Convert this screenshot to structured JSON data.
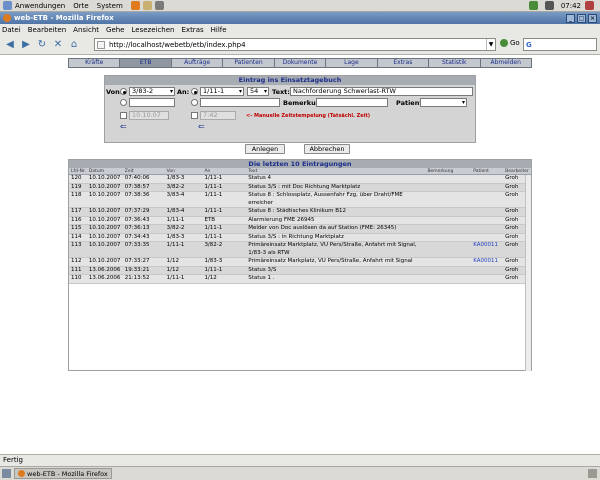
{
  "panel": {
    "menus": [
      "Anwendungen",
      "Orte",
      "System"
    ],
    "clock": "07:42"
  },
  "window": {
    "title": "web-ETB - Mozilla Firefox",
    "controls": [
      "_",
      "□",
      "×"
    ]
  },
  "menubar": [
    "Datei",
    "Bearbeiten",
    "Ansicht",
    "Gehe",
    "Lesezeichen",
    "Extras",
    "Hilfe"
  ],
  "nav": {
    "icons": [
      "back-icon",
      "forward-icon",
      "reload-icon",
      "stop-icon",
      "home-icon"
    ],
    "glyphs": [
      "◀",
      "▶",
      "↻",
      "✕",
      "⌂"
    ],
    "url": "http://localhost/webetb/etb/index.php4",
    "go_label": "Go",
    "search_logo": "G"
  },
  "tabs": [
    {
      "label": "Kräfte",
      "active": false
    },
    {
      "label": "ETB",
      "active": true
    },
    {
      "label": "Aufträge",
      "active": false
    },
    {
      "label": "Patienten",
      "active": false
    },
    {
      "label": "Dokumente",
      "active": false
    },
    {
      "label": "Lage",
      "active": false
    },
    {
      "label": "Extras",
      "active": false
    },
    {
      "label": "Statistik",
      "active": false
    },
    {
      "label": "Abmelden",
      "active": false
    }
  ],
  "entry": {
    "title": "Eintrag ins Einsatztagebuch",
    "von_label": "Von:",
    "an_label": "An:",
    "text_label": "Text:",
    "bemerkung_label": "Bemerkung:",
    "patient_label": "Patient:",
    "von_value": "3/83-2",
    "an_value": "1/11-1",
    "prio_value": "54",
    "text_value": "Nachforderung Schwerlast-RTW",
    "date_value": "10.10.07",
    "time_value": "7:42",
    "arrow_left": "⇐",
    "warning": "<- Manuelle Zeitstempelung (Tatsächl. Zeit)"
  },
  "buttons": {
    "add": "Anlegen",
    "cancel": "Abbrechen"
  },
  "list": {
    "title": "Die letzten 10 Eintragungen",
    "columns": [
      "Lfd-Nr.",
      "Datum",
      "Zeit",
      "Von",
      "An",
      "Text",
      "Bemerkung",
      "Patient",
      "Bearbeiter"
    ],
    "rows": [
      {
        "nr": "120",
        "date": "10.10.2007",
        "time": "07:40:06",
        "von": "1/83-3",
        "an": "1/11-1",
        "text": "Status 4",
        "bem": "",
        "pat": "",
        "bea": "Groh"
      },
      {
        "nr": "119",
        "date": "10.10.2007",
        "time": "07:38:57",
        "von": "3/82-2",
        "an": "1/11-1",
        "text": "Status 3/S : mit Doc Richtung Marktplatz",
        "bem": "",
        "pat": "",
        "bea": "Groh"
      },
      {
        "nr": "118",
        "date": "10.10.2007",
        "time": "07:38:36",
        "von": "3/83-4",
        "an": "1/11-1",
        "text": "Status 8 : Schlossplatz, Aussenfahr Fzg, über Draht/FME erreicher",
        "bem": "",
        "pat": "",
        "bea": "Groh"
      },
      {
        "nr": "117",
        "date": "10.10.2007",
        "time": "07:37:29",
        "von": "1/83-4",
        "an": "1/11-1",
        "text": "Status 8 : Städtisches Klinikum B12",
        "bem": "",
        "pat": "",
        "bea": "Groh"
      },
      {
        "nr": "116",
        "date": "10.10.2007",
        "time": "07:36:43",
        "von": "1/11-1",
        "an": "ETB",
        "text": "Alarmierung FME 26945",
        "bem": "",
        "pat": "",
        "bea": "Groh"
      },
      {
        "nr": "115",
        "date": "10.10.2007",
        "time": "07:36:13",
        "von": "3/82-2",
        "an": "1/11-1",
        "text": "Melder von Doc auslösen da auf Station (FME: 26345)",
        "bem": "",
        "pat": "",
        "bea": "Groh"
      },
      {
        "nr": "114",
        "date": "10.10.2007",
        "time": "07:34:43",
        "von": "1/83-3",
        "an": "1/11-1",
        "text": "Status 3/S : in Richtung Marktplatz",
        "bem": "",
        "pat": "",
        "bea": "Groh"
      },
      {
        "nr": "113",
        "date": "10.10.2007",
        "time": "07:33:35",
        "von": "1/11-1",
        "an": "3/82-2",
        "text": "Primäreinsatz Marktplatz, VU Pers/Straße, Anfahrt mit Signal, 1/83-3 als RTW",
        "bem": "",
        "pat": "KA00011",
        "bea": "Groh"
      },
      {
        "nr": "112",
        "date": "10.10.2007",
        "time": "07:33:27",
        "von": "1/12",
        "an": "1/83-3",
        "text": "Primäreinsatz Markplatz, VU Pers/Straße, Anfahrt mit Signal",
        "bem": "",
        "pat": "KA00011",
        "bea": "Groh"
      },
      {
        "nr": "111",
        "date": "13.06.2006",
        "time": "19:33:21",
        "von": "1/12",
        "an": "1/11-1",
        "text": "Status 3/S",
        "bem": "",
        "pat": "",
        "bea": "Groh"
      },
      {
        "nr": "110",
        "date": "13.06.2006",
        "time": "21:13:52",
        "von": "1/11-1",
        "an": "1/12",
        "text": "Status 1 .",
        "bem": "",
        "pat": "",
        "bea": "Groh"
      }
    ]
  },
  "status": {
    "text": "Fertig"
  },
  "taskbar": {
    "items": [
      {
        "label": "web-ETB - Mozilla Firefox",
        "active": true
      }
    ]
  }
}
